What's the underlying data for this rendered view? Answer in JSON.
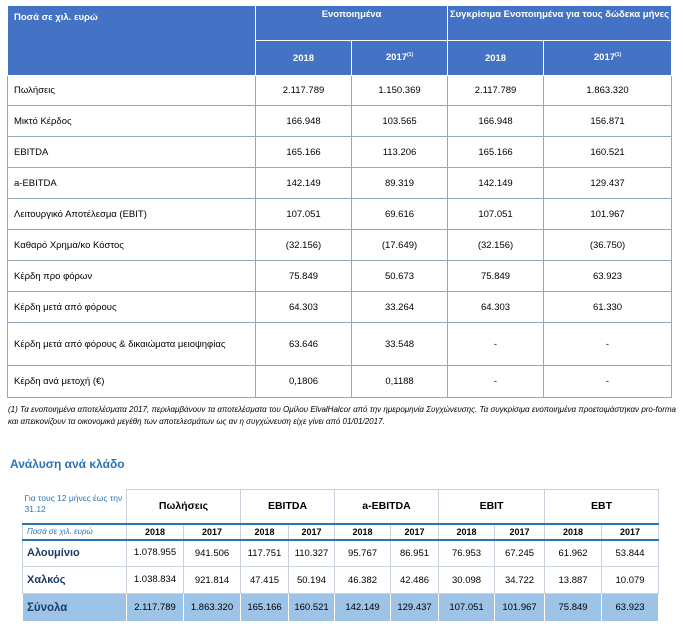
{
  "table1": {
    "corner": "Ποσά σε χιλ. ευρώ",
    "group1": "Ενοποιημένα",
    "group2": "Συγκρίσιμα Ενοποιημένα για τους δώδεκα μήνες",
    "years": [
      "2018",
      "2017",
      "2018",
      "2017"
    ],
    "year_sup": "(1)",
    "rows": [
      {
        "label": "Πωλήσεις",
        "v": [
          "2.117.789",
          "1.150.369",
          "2.117.789",
          "1.863.320"
        ]
      },
      {
        "label": "Μικτό Κέρδος",
        "v": [
          "166.948",
          "103.565",
          "166.948",
          "156.871"
        ]
      },
      {
        "label": "EBITDA",
        "v": [
          "165.166",
          "113.206",
          "165.166",
          "160.521"
        ]
      },
      {
        "label": "a-EBITDA",
        "v": [
          "142.149",
          "89.319",
          "142.149",
          "129.437"
        ]
      },
      {
        "label": "Λειτουργικό Αποτέλεσμα (EBIT)",
        "v": [
          "107.051",
          "69.616",
          "107.051",
          "101.967"
        ]
      },
      {
        "label": "Καθαρό Χρημα/κο Κόστος",
        "v": [
          "(32.156)",
          "(17.649)",
          "(32.156)",
          "(36.750)"
        ]
      },
      {
        "label": "Κέρδη προ φόρων",
        "v": [
          "75.849",
          "50.673",
          "75.849",
          "63.923"
        ]
      },
      {
        "label": "Κέρδη μετά από φόρους",
        "v": [
          "64.303",
          "33.264",
          "64.303",
          "61.330"
        ]
      },
      {
        "label": "Κέρδη μετά από φόρους & δικαιώματα μειοψηφίας",
        "v": [
          "63.646",
          "33.548",
          "-",
          "-"
        ]
      },
      {
        "label": "Κέρδη ανά μετοχή (€)",
        "v": [
          "0,1806",
          "0,1188",
          "-",
          "-"
        ]
      }
    ]
  },
  "footnote": "(1) Τα ενοποιημένα αποτελέσματα 2017, περιλαμβάνουν τα αποτελέσματα του Ομίλου ElvalHalcor από την ημερομηνία Συγχώνευσης. Τα συγκρίσιμα ενοποιημένα προετοιμάστηκαν pro-forma και απεικονίζουν τα οικονομικά μεγέθη των αποτελεσμάτων ως αν η συγχώνευση είχε γίνει από 01/01/2017.",
  "section_title": "Ανάλυση ανά κλάδο",
  "table2": {
    "caption": "Για τους 12 μήνες έως την 31.12",
    "unit": "Ποσά σε χιλ. ευρώ",
    "groups": [
      "Πωλήσεις",
      "EBITDA",
      "a-EBITDA",
      "EBIT",
      "EBT"
    ],
    "years": [
      "2018",
      "2017",
      "2018",
      "2017",
      "2018",
      "2017",
      "2018",
      "2017",
      "2018",
      "2017"
    ],
    "rows": [
      {
        "label": "Αλουμίνιο",
        "v": [
          "1.078.955",
          "941.506",
          "117.751",
          "110.327",
          "95.767",
          "86.951",
          "76.953",
          "67.245",
          "61.962",
          "53.844"
        ]
      },
      {
        "label": "Χαλκός",
        "v": [
          "1.038.834",
          "921.814",
          "47.415",
          "50.194",
          "46.382",
          "42.486",
          "30.098",
          "34.722",
          "13.887",
          "10.079"
        ]
      },
      {
        "label": "Σύνολα",
        "v": [
          "2.117.789",
          "1.863.320",
          "165.166",
          "160.521",
          "142.149",
          "129.437",
          "107.051",
          "101.967",
          "75.849",
          "63.923"
        ]
      }
    ]
  }
}
